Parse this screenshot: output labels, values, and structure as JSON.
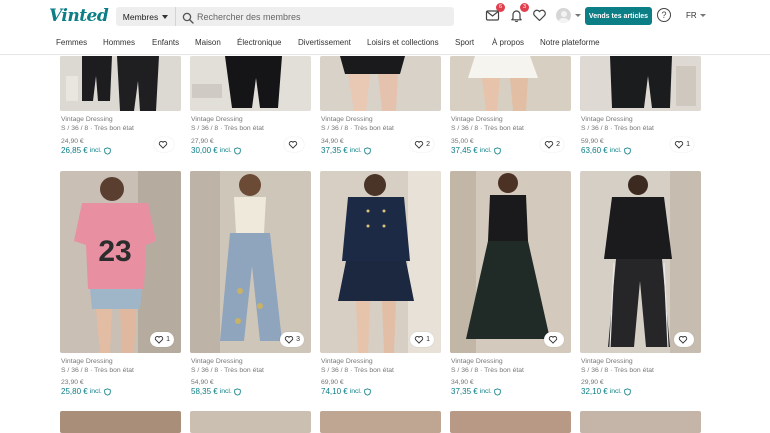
{
  "header": {
    "logo": "Vinted",
    "search_scope": "Membres",
    "search_placeholder": "Rechercher des membres",
    "notifications": [
      {
        "icon": "inbox-icon",
        "count": "6"
      },
      {
        "icon": "bell-icon",
        "count": "3"
      }
    ],
    "favorites_icon": "heart-icon",
    "sell_button": "Vends tes articles",
    "help": "?",
    "language": "FR"
  },
  "nav": [
    "Femmes",
    "Hommes",
    "Enfants",
    "Maison",
    "Électronique",
    "Divertissement",
    "Loisirs et collections",
    "Sport",
    "À propos",
    "Notre plateforme"
  ],
  "colors": {
    "brand": "#0b7e86",
    "badge": "#e0404e",
    "text_muted": "#777777"
  },
  "rows": [
    {
      "items": [
        {
          "seller": "Vintage Dressing",
          "details": "S / 36 / 8 · Très bon état",
          "price": "24,90 €",
          "total": "26,85 €",
          "incl": "incl.",
          "favs": ""
        },
        {
          "seller": "Vintage Dressing",
          "details": "S / 36 / 8 · Très bon état",
          "price": "27,90 €",
          "total": "30,00 €",
          "incl": "incl.",
          "favs": ""
        },
        {
          "seller": "Vintage Dressing",
          "details": "S / 36 / 8 · Très bon état",
          "price": "34,90 €",
          "total": "37,35 €",
          "incl": "incl.",
          "favs": "2"
        },
        {
          "seller": "Vintage Dressing",
          "details": "S / 36 / 8 · Très bon état",
          "price": "35,00 €",
          "total": "37,45 €",
          "incl": "incl.",
          "favs": "2"
        },
        {
          "seller": "Vintage Dressing",
          "details": "S / 36 / 8 · Très bon état",
          "price": "59,90 €",
          "total": "63,60 €",
          "incl": "incl.",
          "favs": "1"
        }
      ]
    },
    {
      "items": [
        {
          "seller": "Vintage Dressing",
          "details": "S / 36 / 8 · Très bon état",
          "price": "23,90 €",
          "total": "25,80 €",
          "incl": "incl.",
          "favs": "1"
        },
        {
          "seller": "Vintage Dressing",
          "details": "S / 36 / 8 · Très bon état",
          "price": "54,90 €",
          "total": "58,35 €",
          "incl": "incl.",
          "favs": "3"
        },
        {
          "seller": "Vintage Dressing",
          "details": "S / 36 / 8 · Très bon état",
          "price": "69,90 €",
          "total": "74,10 €",
          "incl": "incl.",
          "favs": "1"
        },
        {
          "seller": "Vintage Dressing",
          "details": "S / 36 / 8 · Très bon état",
          "price": "34,90 €",
          "total": "37,35 €",
          "incl": "incl.",
          "favs": ""
        },
        {
          "seller": "Vintage Dressing",
          "details": "S / 36 / 8 · Très bon état",
          "price": "29,90 €",
          "total": "32,10 €",
          "incl": "incl.",
          "favs": ""
        }
      ]
    }
  ]
}
